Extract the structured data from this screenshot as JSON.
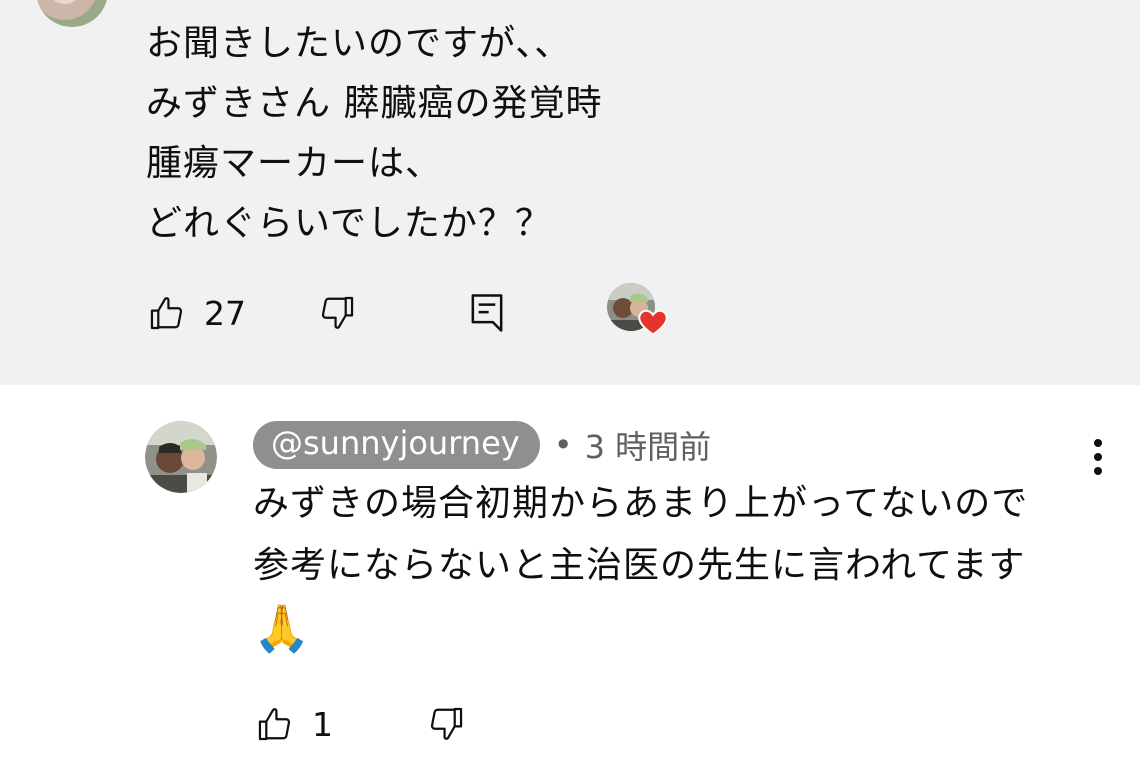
{
  "top_comment": {
    "lines": [
      "お聞きしたいのですが、、",
      "みずきさん 膵臓癌の発覚時",
      "腫瘍マーカーは、",
      "どれぐらいでしたか？？"
    ],
    "like_count": "27",
    "icons": {
      "like": "thumbs-up-icon",
      "dislike": "thumbs-down-icon",
      "reply": "reply-icon",
      "creator_heart": "heart-icon",
      "more": "more-vert-icon"
    }
  },
  "reply": {
    "handle": "@sunnyjourney",
    "separator": "•",
    "time": "3 時間前",
    "lines": [
      "みずきの場合初期からあまり上がってないので",
      "参考にならないと主治医の先生に言われてます"
    ],
    "emoji": "🙏",
    "like_count": "1",
    "icons": {
      "like": "thumbs-up-icon",
      "dislike": "thumbs-down-icon",
      "more": "more-vert-icon"
    }
  },
  "colors": {
    "highlight_bg": "#f1f1f1",
    "handle_chip_bg": "#8f8f8f",
    "heart": "#e5342b",
    "text": "#0f0f0f",
    "meta": "#606060"
  }
}
